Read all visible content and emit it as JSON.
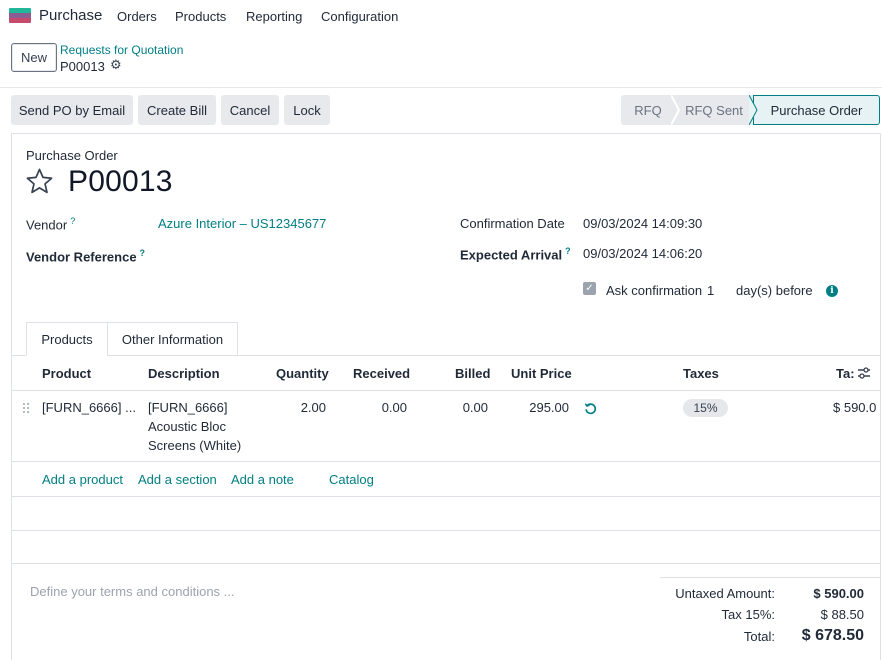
{
  "app": {
    "name": "Purchase"
  },
  "nav": {
    "orders": "Orders",
    "products": "Products",
    "reporting": "Reporting",
    "configuration": "Configuration"
  },
  "control": {
    "new_label": "New",
    "breadcrumb_parent": "Requests for Quotation",
    "breadcrumb_current": "P00013"
  },
  "actions": {
    "send_po": "Send PO by Email",
    "create_bill": "Create Bill",
    "cancel": "Cancel",
    "lock": "Lock"
  },
  "status": {
    "stages": [
      "RFQ",
      "RFQ Sent",
      "Purchase Order"
    ],
    "current": "Purchase Order"
  },
  "form": {
    "doc_type": "Purchase Order",
    "name": "P00013",
    "vendor_label": "Vendor",
    "vendor_value": "Azure Interior – US12345677",
    "vendor_ref_label": "Vendor Reference",
    "confirmation_label": "Confirmation Date",
    "confirmation_value": "09/03/2024 14:09:30",
    "expected_label": "Expected Arrival",
    "expected_value": "09/03/2024 14:06:20",
    "ask_confirmation_label": "Ask confirmation",
    "ask_confirmation_days": "1",
    "days_before": "day(s) before",
    "help_mark": "?"
  },
  "tabs": {
    "products": "Products",
    "other": "Other Information"
  },
  "table": {
    "headers": {
      "product": "Product",
      "description": "Description",
      "quantity": "Quantity",
      "received": "Received",
      "billed": "Billed",
      "unit_price": "Unit Price",
      "taxes": "Taxes",
      "tax_excl": "Ta:"
    },
    "rows": [
      {
        "product": "[FURN_6666] ...",
        "description_1": "[FURN_6666]",
        "description_2": "Acoustic Bloc",
        "description_3": "Screens (White)",
        "quantity": "2.00",
        "received": "0.00",
        "billed": "0.00",
        "unit_price": "295.00",
        "tax": "15%",
        "subtotal": "$ 590.0"
      }
    ],
    "add_product": "Add a product",
    "add_section": "Add a section",
    "add_note": "Add a note",
    "catalog": "Catalog"
  },
  "footer": {
    "terms_placeholder": "Define your terms and conditions ...",
    "untaxed_label": "Untaxed Amount:",
    "untaxed_value": "$ 590.00",
    "tax_label": "Tax 15%:",
    "tax_value": "$ 88.50",
    "total_label": "Total:",
    "total_value": "$ 678.50"
  },
  "colors": {
    "accent": "#017e84",
    "button_bg": "#e7e9ed"
  }
}
